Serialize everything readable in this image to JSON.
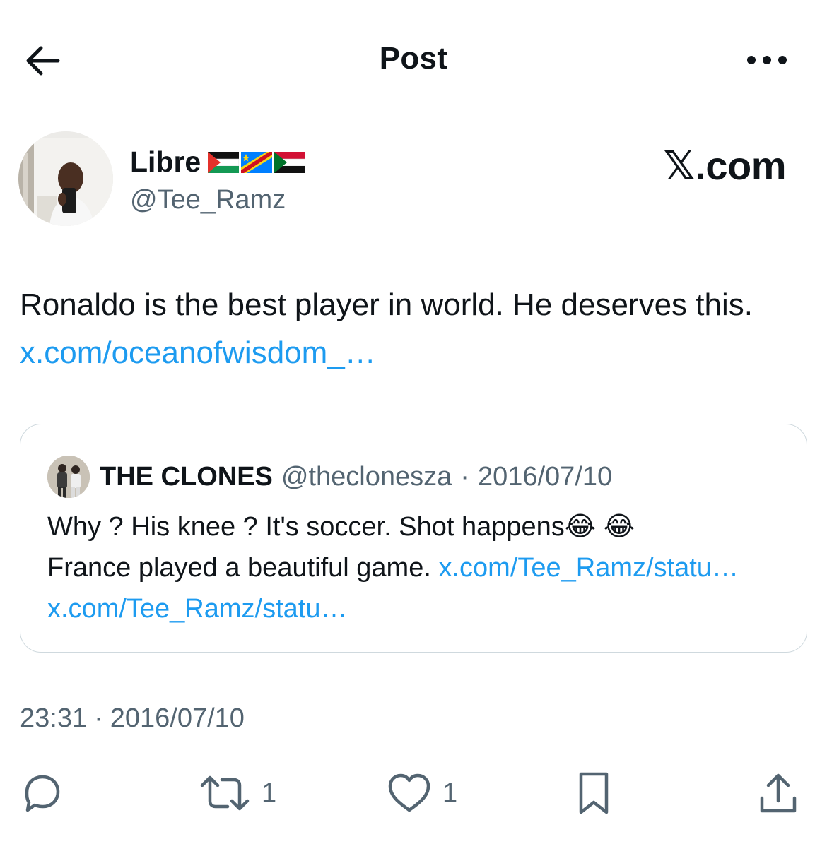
{
  "header": {
    "title": "Post",
    "back_icon": "arrow-left-icon",
    "more_icon": "more-horizontal-icon"
  },
  "author": {
    "display_name": "Libre",
    "flags": [
      "Palestine flag",
      "DR Congo flag",
      "Sudan flag"
    ],
    "handle": "@Tee_Ramz",
    "watermark": "𝕏.com"
  },
  "post": {
    "text": "Ronaldo is the best player in world. He deserves this.",
    "link": "x.com/oceanofwisdom_…"
  },
  "quote": {
    "display_name": "THE CLONES",
    "handle": "@theclonesza",
    "separator": "·",
    "date": "2016/07/10",
    "line1": "Why ? His knee ? It's soccer. Shot happens",
    "emoji": "😂 😂",
    "line2": "France played a beautiful game.",
    "link1": "x.com/Tee_Ramz/statu…",
    "link2": "x.com/Tee_Ramz/statu…"
  },
  "meta": {
    "time": "23:31",
    "separator": "·",
    "date": "2016/07/10"
  },
  "actions": {
    "reply_icon": "reply-icon",
    "repost_icon": "repost-icon",
    "repost_count": "1",
    "like_icon": "heart-icon",
    "like_count": "1",
    "bookmark_icon": "bookmark-icon",
    "share_icon": "share-icon"
  },
  "colors": {
    "text": "#0f1419",
    "secondary": "#536471",
    "link": "#1d9bf0",
    "border": "#cfd9de"
  }
}
